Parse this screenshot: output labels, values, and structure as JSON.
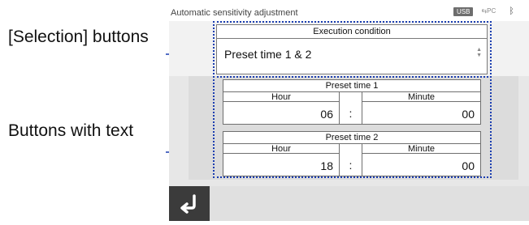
{
  "callouts": {
    "selection_buttons": "[Selection] buttons",
    "buttons_with_text": "Buttons with text"
  },
  "screen": {
    "title": "Automatic sensitivity adjustment",
    "status": {
      "usb": "USB",
      "pc": "PC"
    },
    "execution_condition": {
      "header": "Execution condition",
      "value": "Preset time 1 & 2"
    },
    "presets": [
      {
        "title": "Preset time 1",
        "hour_label": "Hour",
        "minute_label": "Minute",
        "hour": "06",
        "separator": ":",
        "minute": "00"
      },
      {
        "title": "Preset time 2",
        "hour_label": "Hour",
        "minute_label": "Minute",
        "hour": "18",
        "separator": ":",
        "minute": "00"
      }
    ],
    "back_icon": "return-arrow-icon"
  },
  "colors": {
    "highlight": "#1a3db0",
    "back_button": "#3b3b3b"
  }
}
